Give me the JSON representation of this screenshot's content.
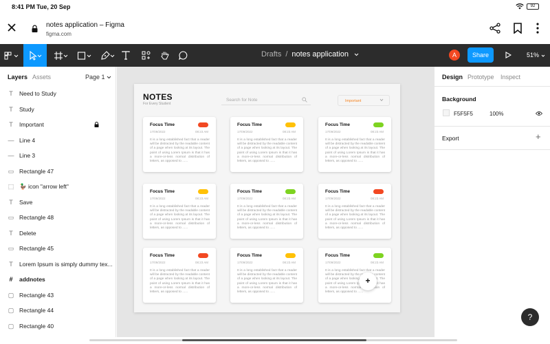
{
  "status_bar": {
    "time": "8:41 PM",
    "date": "Tue, 20 Sep",
    "battery": "92"
  },
  "browser": {
    "title": "notes application – Figma",
    "url": "figma.com"
  },
  "toolbar": {
    "breadcrumb_root": "Drafts",
    "breadcrumb_sep": "/",
    "file_name": "notes application",
    "avatar_initial": "A",
    "share_label": "Share",
    "zoom": "51%"
  },
  "left_panel": {
    "tabs": {
      "layers": "Layers",
      "assets": "Assets",
      "page": "Page 1"
    },
    "layers": [
      {
        "icon": "text-icon",
        "glyph": "T",
        "name": "Need to Study"
      },
      {
        "icon": "text-icon",
        "glyph": "T",
        "name": "Study"
      },
      {
        "icon": "text-icon",
        "glyph": "T",
        "name": "Important",
        "locked": true
      },
      {
        "icon": "line-icon",
        "glyph": "—",
        "name": "Line 4"
      },
      {
        "icon": "line-icon",
        "glyph": "—",
        "name": "Line 3"
      },
      {
        "icon": "rectangle-icon",
        "glyph": "▭",
        "name": "Rectangle 47"
      },
      {
        "icon": "component-icon",
        "glyph": "⬚",
        "name": "🦆 icon \"arrow left\""
      },
      {
        "icon": "text-icon",
        "glyph": "T",
        "name": "Save"
      },
      {
        "icon": "rectangle-icon",
        "glyph": "▭",
        "name": "Rectangle 48"
      },
      {
        "icon": "text-icon",
        "glyph": "T",
        "name": "Delete"
      },
      {
        "icon": "rectangle-icon",
        "glyph": "▭",
        "name": "Rectangle 45"
      },
      {
        "icon": "text-icon",
        "glyph": "T",
        "name": "Lorem Ipsum is simply dummy tex..."
      },
      {
        "icon": "frame-icon",
        "glyph": "#",
        "name": "addnotes"
      },
      {
        "icon": "rectangle-icon",
        "glyph": "▢",
        "name": "Rectangle 43"
      },
      {
        "icon": "rectangle-icon",
        "glyph": "▢",
        "name": "Rectangle 44"
      },
      {
        "icon": "rectangle-icon",
        "glyph": "▢",
        "name": "Rectangle 40"
      }
    ]
  },
  "frame": {
    "title": "NOTES",
    "subtitle": "For Every Student",
    "search_placeholder": "Search for Note",
    "filter": "Important",
    "add_label": "+",
    "cards": [
      {
        "title": "Focus Time",
        "date": "17/09/2022",
        "time": "08:23 AM",
        "color": "#f24822"
      },
      {
        "title": "Focus Time",
        "date": "17/09/2022",
        "time": "08:23 AM",
        "color": "#ffc107"
      },
      {
        "title": "Focus Time",
        "date": "17/09/2022",
        "time": "08:23 AM",
        "color": "#7ed321"
      },
      {
        "title": "Focus Time",
        "date": "17/09/2022",
        "time": "08:23 AM",
        "color": "#ffc107"
      },
      {
        "title": "Focus Time",
        "date": "17/09/2022",
        "time": "08:23 AM",
        "color": "#7ed321"
      },
      {
        "title": "Focus Time",
        "date": "17/09/2022",
        "time": "08:23 AM",
        "color": "#f24822"
      },
      {
        "title": "Focus Time",
        "date": "17/09/2022",
        "time": "08:23 AM",
        "color": "#f24822"
      },
      {
        "title": "Focus Time",
        "date": "17/09/2022",
        "time": "08:23 AM",
        "color": "#ffc107"
      },
      {
        "title": "Focus Time",
        "date": "17/09/2022",
        "time": "08:23 AM",
        "color": "#7ed321"
      }
    ],
    "card_body": "It is a long established fact that a reader will be distracted by the readable content of a page when looking at its layout. The point of using Lorem Ipsum is that it has a more-or-less normal distribution of letters, as opposed to ......"
  },
  "right_panel": {
    "tabs": {
      "design": "Design",
      "prototype": "Prototype",
      "inspect": "Inspect"
    },
    "background_label": "Background",
    "bg_hex": "F5F5F5",
    "bg_opacity": "100%",
    "export_label": "Export",
    "help": "?"
  }
}
